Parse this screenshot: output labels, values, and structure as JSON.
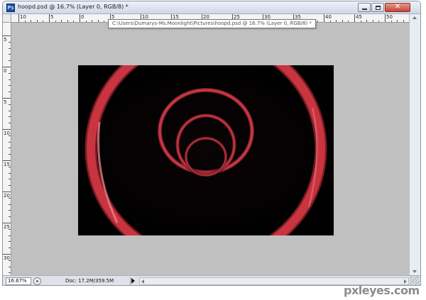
{
  "window": {
    "title": "hoopd.psd @ 16.7% (Layer 0, RGB/8) *",
    "tooltip": "C:\\Users\\Dumarys-Ms.Moonlight\\Pictures\\hoopd.psd @ 16.7% (Layer 0, RGB/8) *",
    "app_icon_label": "Ps",
    "close_glyph": "✕"
  },
  "rulers": {
    "horizontal": [
      "10",
      "5",
      "0",
      "5",
      "10",
      "15",
      "20",
      "25",
      "30",
      "35",
      "40",
      "45",
      "50",
      "55"
    ],
    "vertical": [
      "5",
      "0",
      "5",
      "10",
      "15",
      "20",
      "25",
      "30"
    ]
  },
  "status": {
    "zoom": "16.67%",
    "doc": "Doc: 17.2M/359.5M"
  },
  "watermark": "pxleyes.com",
  "colors": {
    "canvas_bg": "#c0c0c0",
    "image_bg": "#020202",
    "hoop_red": "#c8343f"
  },
  "icons": {
    "app": "photoshop-icon",
    "status": "status-icon",
    "doc_menu": "triangle-right-icon"
  }
}
